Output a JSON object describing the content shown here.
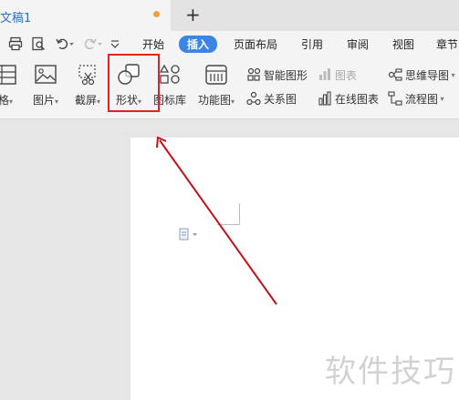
{
  "tab": {
    "title": "文稿1"
  },
  "menu": {
    "items": [
      "开始",
      "插入",
      "页面布局",
      "引用",
      "审阅",
      "视图",
      "章节"
    ],
    "active": "插入"
  },
  "ribbon": {
    "table_label": "格",
    "picture_label": "图片",
    "screenshot_label": "截屏",
    "shape_label": "形状",
    "iconlib_label": "图标库",
    "funcchart_label": "功能图",
    "smartart_label": "智能图形",
    "chart_label": "图表",
    "mindmap_label": "思维导图",
    "relation_label": "关系图",
    "onlinechart_label": "在线图表",
    "flowchart_label": "流程图"
  },
  "document": {
    "watermark": "软件技巧"
  },
  "colors": {
    "accent": "#3c84e5",
    "highlight": "#e12323",
    "arrow": "#c0141a"
  }
}
